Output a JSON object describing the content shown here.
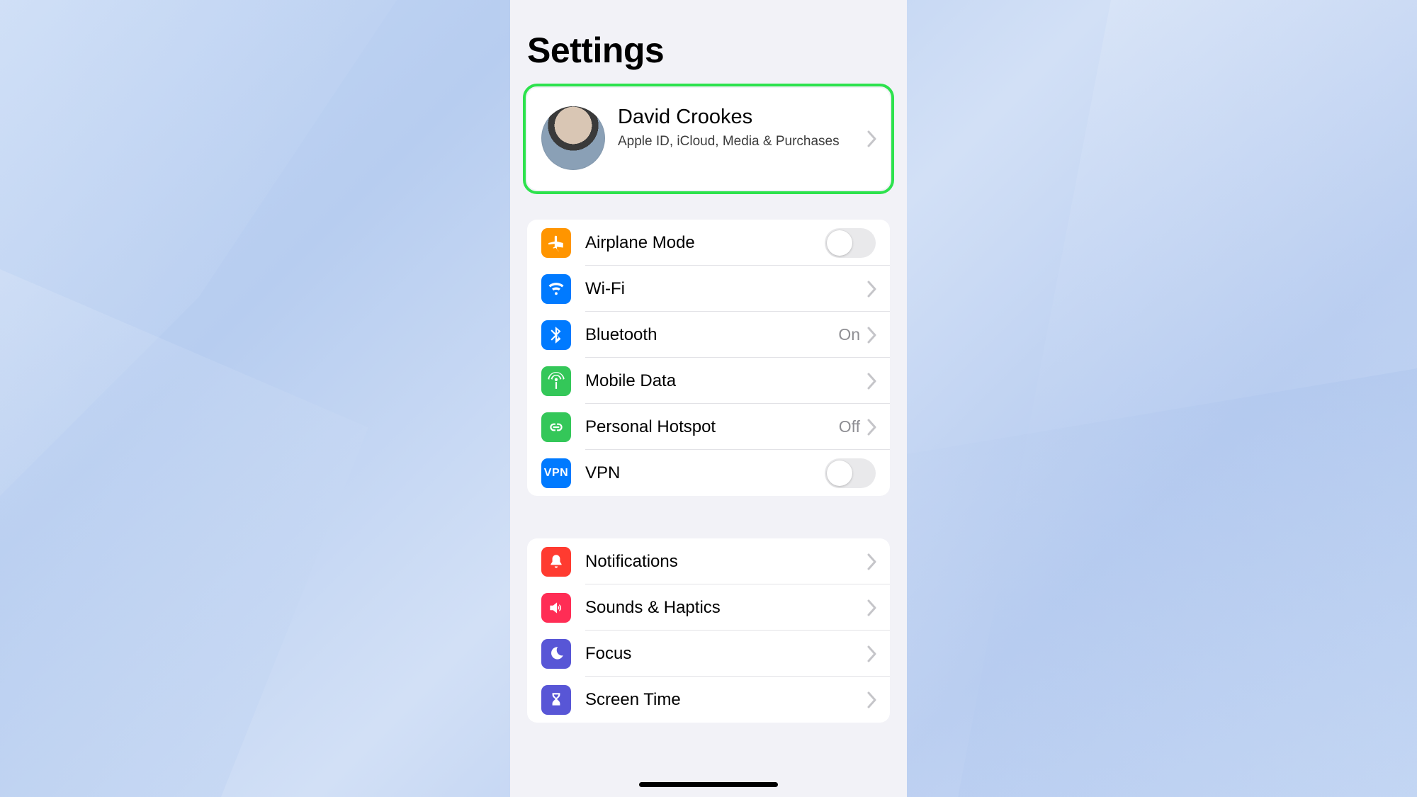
{
  "title": "Settings",
  "profile": {
    "name": "David Crookes",
    "subtitle": "Apple ID, iCloud, Media & Purchases"
  },
  "group_connectivity": [
    {
      "id": "airplane",
      "label": "Airplane Mode",
      "control": "toggle",
      "on": false
    },
    {
      "id": "wifi",
      "label": "Wi-Fi",
      "control": "chevron",
      "value": ""
    },
    {
      "id": "bluetooth",
      "label": "Bluetooth",
      "control": "chevron",
      "value": "On"
    },
    {
      "id": "mobile",
      "label": "Mobile Data",
      "control": "chevron",
      "value": ""
    },
    {
      "id": "hotspot",
      "label": "Personal Hotspot",
      "control": "chevron",
      "value": "Off"
    },
    {
      "id": "vpn",
      "label": "VPN",
      "control": "toggle",
      "on": false
    }
  ],
  "group_system": [
    {
      "id": "notifications",
      "label": "Notifications"
    },
    {
      "id": "sounds",
      "label": "Sounds & Haptics"
    },
    {
      "id": "focus",
      "label": "Focus"
    },
    {
      "id": "screentime",
      "label": "Screen Time"
    }
  ],
  "vpn_badge_text": "VPN"
}
